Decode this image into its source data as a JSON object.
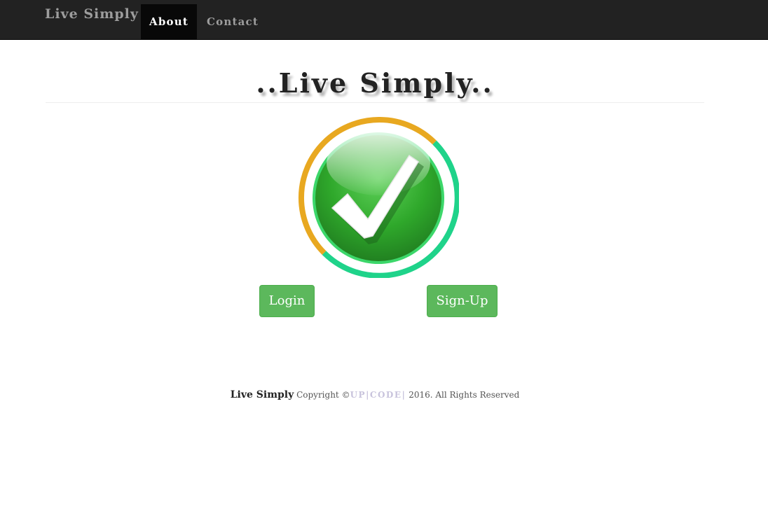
{
  "navbar": {
    "brand": "Live Simply",
    "items": [
      {
        "label": "About",
        "active": true
      },
      {
        "label": "Contact",
        "active": false
      }
    ]
  },
  "hero": {
    "title": "..Live Simply.."
  },
  "logo": {
    "icon": "checkmark-icon",
    "ring_colors": [
      "#E8A820",
      "#1FD38A"
    ],
    "fill_color": "#2E9E28"
  },
  "buttons": {
    "login": "Login",
    "signup": "Sign-Up"
  },
  "footer": {
    "brand": "Live Simply",
    "copyright": "Copyright ©",
    "company": "UP|CODE|",
    "year_text": "2016. All Rights Reserved"
  },
  "colors": {
    "navbar_bg": "#222222",
    "active_tab_bg": "#080808",
    "button_green": "#5CB85C"
  }
}
